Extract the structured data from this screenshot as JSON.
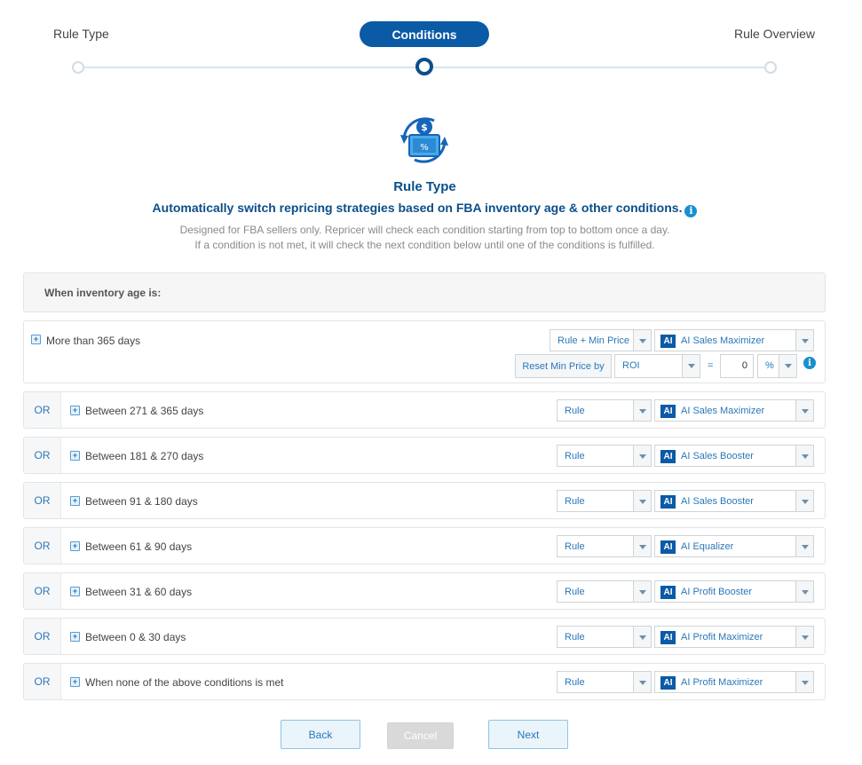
{
  "stepper": {
    "steps": [
      "Rule Type",
      "Conditions",
      "Rule Overview"
    ],
    "active_step": "Conditions"
  },
  "header": {
    "icon": "repricing-cycle-icon",
    "title": "Rule Type",
    "subtitle": "Automatically switch repricing strategies based on FBA inventory age & other conditions.",
    "info_icon": "i",
    "description_line1": "Designed for FBA sellers only. Repricer will check each condition starting from top to bottom once a day.",
    "description_line2": "If a condition is not met, it will check the next condition below until one of the conditions is fulfilled."
  },
  "panel": {
    "heading": "When inventory age is:",
    "first_row": {
      "condition": "More than 365 days",
      "rule_select": "Rule + Min Price",
      "ai_badge": "AI",
      "strategy_select": "AI Sales Maximizer",
      "reset_label": "Reset Min Price by",
      "reset_basis": "ROI",
      "equals": "=",
      "reset_value": "0",
      "reset_unit": "%",
      "info_icon": "i"
    },
    "or_rows": [
      {
        "or": "OR",
        "condition": "Between 271 & 365 days",
        "rule": "Rule",
        "ai": "AI",
        "strategy": "AI Sales Maximizer"
      },
      {
        "or": "OR",
        "condition": "Between 181 & 270 days",
        "rule": "Rule",
        "ai": "AI",
        "strategy": "AI Sales Booster"
      },
      {
        "or": "OR",
        "condition": "Between 91 & 180 days",
        "rule": "Rule",
        "ai": "AI",
        "strategy": "AI Sales Booster"
      },
      {
        "or": "OR",
        "condition": "Between 61 & 90 days",
        "rule": "Rule",
        "ai": "AI",
        "strategy": "AI Equalizer"
      },
      {
        "or": "OR",
        "condition": "Between 31 & 60 days",
        "rule": "Rule",
        "ai": "AI",
        "strategy": "AI Profit Booster"
      },
      {
        "or": "OR",
        "condition": "Between 0 & 30 days",
        "rule": "Rule",
        "ai": "AI",
        "strategy": "AI Profit Maximizer"
      },
      {
        "or": "OR",
        "condition": "When none of the above conditions is met",
        "rule": "Rule",
        "ai": "AI",
        "strategy": "AI Profit Maximizer"
      }
    ]
  },
  "footer": {
    "back": "Back",
    "cancel": "Cancel",
    "next": "Next"
  },
  "colors": {
    "primary": "#0b5aa6",
    "link": "#2b77b8",
    "title": "#0b4f8a",
    "info": "#1a8fd0"
  }
}
